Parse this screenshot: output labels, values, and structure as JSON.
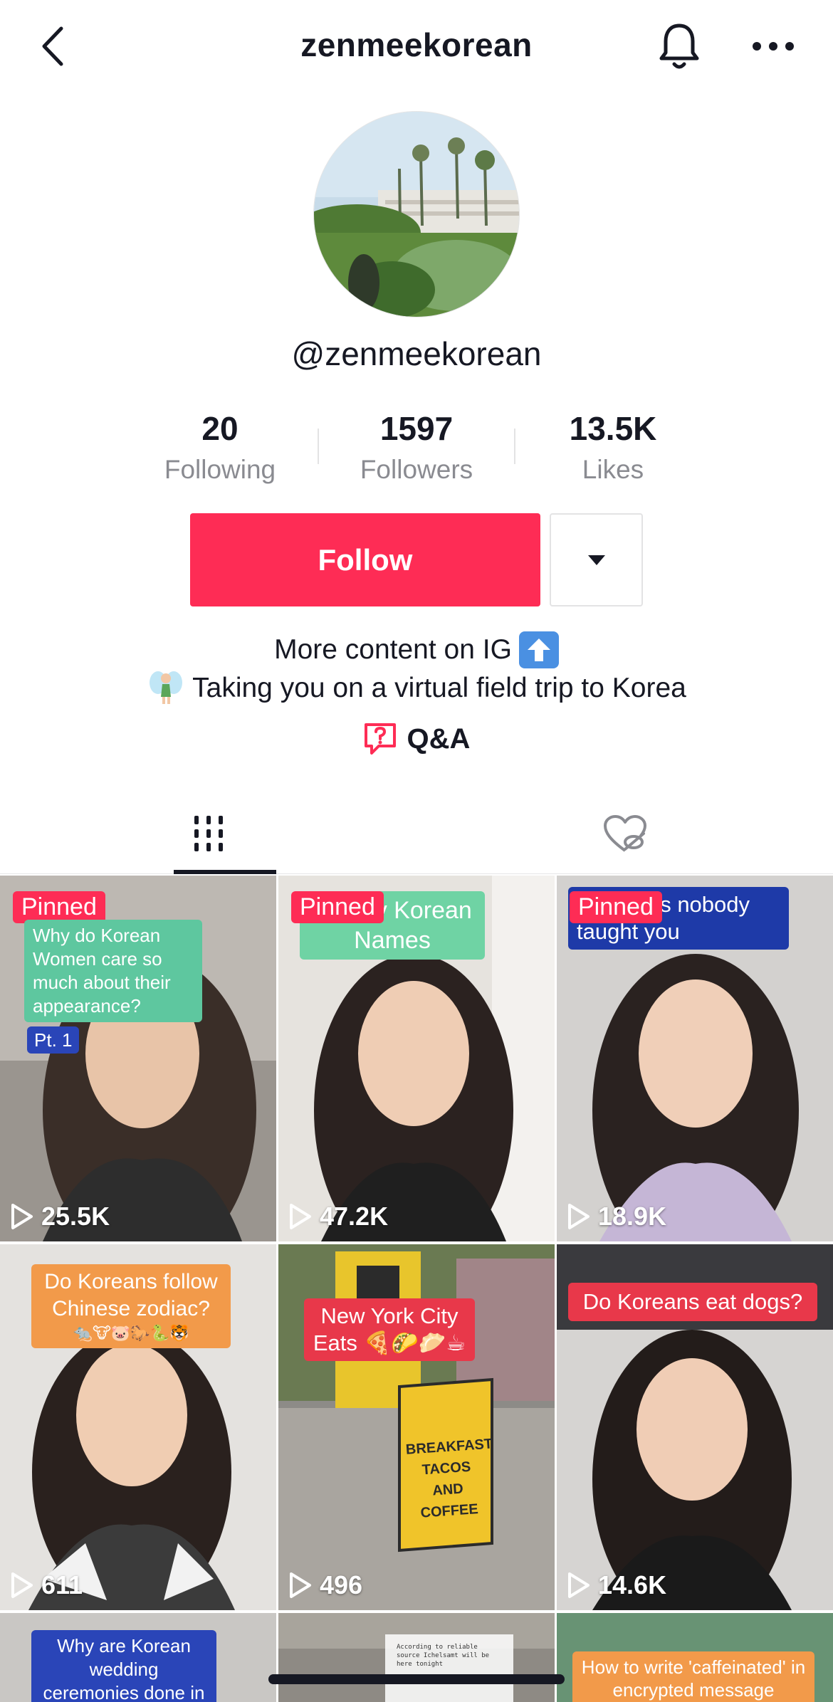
{
  "header": {
    "title": "zenmeekorean"
  },
  "profile": {
    "handle": "@zenmeekorean",
    "stats": [
      {
        "value": "20",
        "label": "Following"
      },
      {
        "value": "1597",
        "label": "Followers"
      },
      {
        "value": "13.5K",
        "label": "Likes"
      }
    ],
    "follow_label": "Follow",
    "bio": [
      "More content on IG",
      "Taking you on a virtual field trip to Korea"
    ],
    "qa_label": "Q&A"
  },
  "colors": {
    "accent": "#fe2c55",
    "text": "#161823",
    "muted": "#8a8b91"
  },
  "icons": {
    "back": "chevron-left-icon",
    "bell": "bell-icon",
    "more": "more-horizontal-icon",
    "dropdown": "caret-down-icon",
    "qa": "question-bubble-icon",
    "videos_tab": "grid-icon",
    "liked_tab": "heart-hidden-icon",
    "play": "play-icon"
  },
  "videos": [
    {
      "pinned": "Pinned",
      "caption": "Why do Korean Women care so much about their appearance?",
      "sub": "Pt. 1",
      "views": "25.5K"
    },
    {
      "pinned": "Pinned",
      "caption": "Trendy Korean Names",
      "views": "47.2K"
    },
    {
      "pinned": "Pinned",
      "caption": "an slangs nobody taught you",
      "views": "18.9K"
    },
    {
      "caption": "Do Koreans follow Chinese zodiac?",
      "views": "611"
    },
    {
      "caption": "New York City Eats",
      "sign": [
        "BREAKFAST TACOS",
        "AND",
        "COFFEE"
      ],
      "views": "496"
    },
    {
      "caption": "Do Koreans eat dogs?",
      "views": "14.6K"
    },
    {
      "caption": "Why are Korean wedding ceremonies done in a rush?"
    },
    {
      "caption": "According to reliable source Ichelsamt will be here tonight"
    },
    {
      "caption": "How to write 'caffeinated' in encrypted message"
    }
  ]
}
